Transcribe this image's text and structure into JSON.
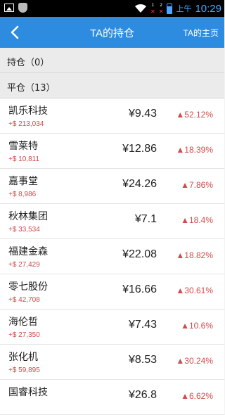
{
  "status_bar": {
    "ampm": "上午",
    "time": "10:29",
    "colors": {
      "accent": "#4aa8ff"
    }
  },
  "header": {
    "title": "TA的持仓",
    "right_link": "TA的主页",
    "colors": {
      "bg": "#2e8ce0"
    }
  },
  "sections": {
    "holding": "持仓（0）",
    "closed": "平仓（13）"
  },
  "stocks": [
    {
      "name": "凯乐科技",
      "profit": "+$ 213,034",
      "price": "¥9.43",
      "change": "▲52.12%"
    },
    {
      "name": "雪莱特",
      "profit": "+$ 10,811",
      "price": "¥12.86",
      "change": "▲18.39%"
    },
    {
      "name": "嘉事堂",
      "profit": "+$ 8,986",
      "price": "¥24.26",
      "change": "▲7.86%"
    },
    {
      "name": "秋林集团",
      "profit": "+$ 33,534",
      "price": "¥7.1",
      "change": "▲18.4%"
    },
    {
      "name": "福建金森",
      "profit": "+$ 27,429",
      "price": "¥22.08",
      "change": "▲18.82%"
    },
    {
      "name": "零七股份",
      "profit": "+$ 42,708",
      "price": "¥16.66",
      "change": "▲30.61%"
    },
    {
      "name": "海伦哲",
      "profit": "+$ 27,350",
      "price": "¥7.43",
      "change": "▲10.6%"
    },
    {
      "name": "张化机",
      "profit": "+$ 59,895",
      "price": "¥8.53",
      "change": "▲30.24%"
    },
    {
      "name": "国睿科技",
      "profit": "",
      "price": "¥26.8",
      "change": "▲6.62%"
    }
  ],
  "colors": {
    "up": "#d14b4b"
  }
}
